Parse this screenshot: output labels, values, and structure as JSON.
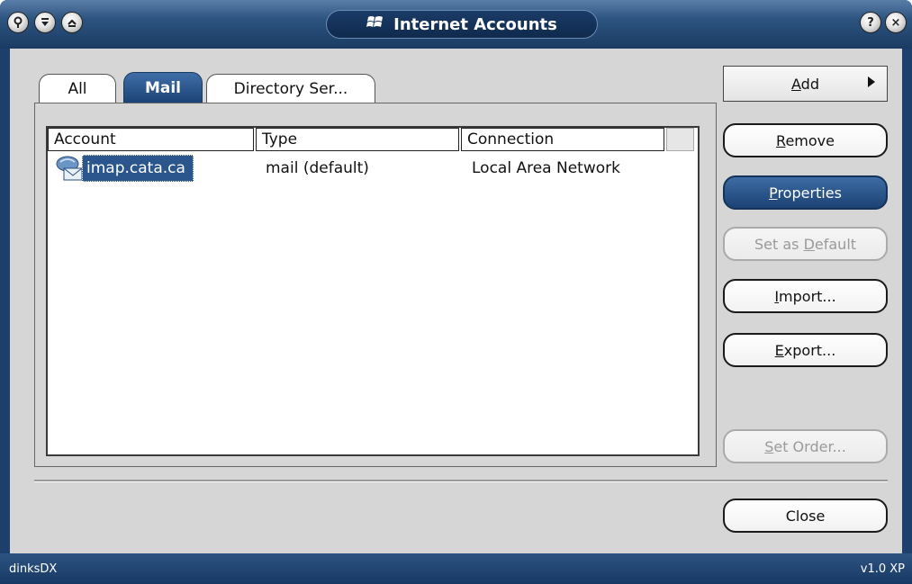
{
  "window": {
    "title": "Internet Accounts",
    "title_icon": "windows-flag-icon",
    "left_buttons": [
      "pin-icon",
      "minimize-icon",
      "restore-icon"
    ],
    "right_buttons": [
      "help-icon",
      "close-icon"
    ],
    "help_glyph": "?",
    "close_glyph": "×"
  },
  "tabs": [
    {
      "label": "All",
      "active": false
    },
    {
      "label": "Mail",
      "active": true
    },
    {
      "label": "Directory Ser...",
      "active": false
    }
  ],
  "list": {
    "columns": [
      "Account",
      "Type",
      "Connection"
    ],
    "rows": [
      {
        "account": "imap.cata.ca",
        "type": "mail (default)",
        "connection": "Local Area Network",
        "icon": "mail-account-icon",
        "selected": true
      }
    ]
  },
  "buttons": {
    "add": {
      "pre": "",
      "key": "A",
      "post": "dd"
    },
    "remove": {
      "pre": "",
      "key": "R",
      "post": "emove"
    },
    "properties": {
      "pre": "",
      "key": "P",
      "post": "roperties"
    },
    "set_default": {
      "pre": "Set as ",
      "key": "D",
      "post": "efault"
    },
    "import": {
      "pre": "",
      "key": "I",
      "post": "mport..."
    },
    "export": {
      "pre": "",
      "key": "E",
      "post": "xport..."
    },
    "set_order": {
      "pre": "",
      "key": "S",
      "post": "et Order..."
    },
    "close": "Close"
  },
  "status": {
    "left": "dinksDX",
    "right": "v1.0 XP"
  },
  "colors": {
    "frame": "#1d3f6b",
    "accent": "#2a568d",
    "face": "#d6d6d6"
  }
}
